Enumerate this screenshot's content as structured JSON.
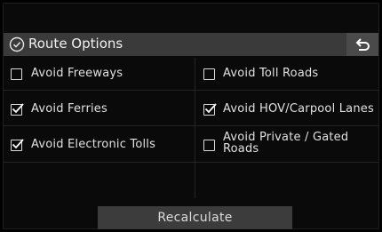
{
  "header": {
    "title": "Route Options",
    "title_icon": "check-circle-icon",
    "back_icon": "return-arrow-icon"
  },
  "options": [
    {
      "label": "Avoid Freeways",
      "checked": false
    },
    {
      "label": "Avoid Toll Roads",
      "checked": false
    },
    {
      "label": "Avoid Ferries",
      "checked": true
    },
    {
      "label": "Avoid HOV/Carpool Lanes",
      "checked": true
    },
    {
      "label": "Avoid Electronic Tolls",
      "checked": true
    },
    {
      "label": "Avoid Private / Gated Roads",
      "checked": false
    }
  ],
  "footer": {
    "recalculate_label": "Recalculate"
  },
  "colors": {
    "background": "#000000",
    "header_bar": "#3a3a3a",
    "button": "#3c3c3c",
    "text": "#e6e6e6"
  }
}
